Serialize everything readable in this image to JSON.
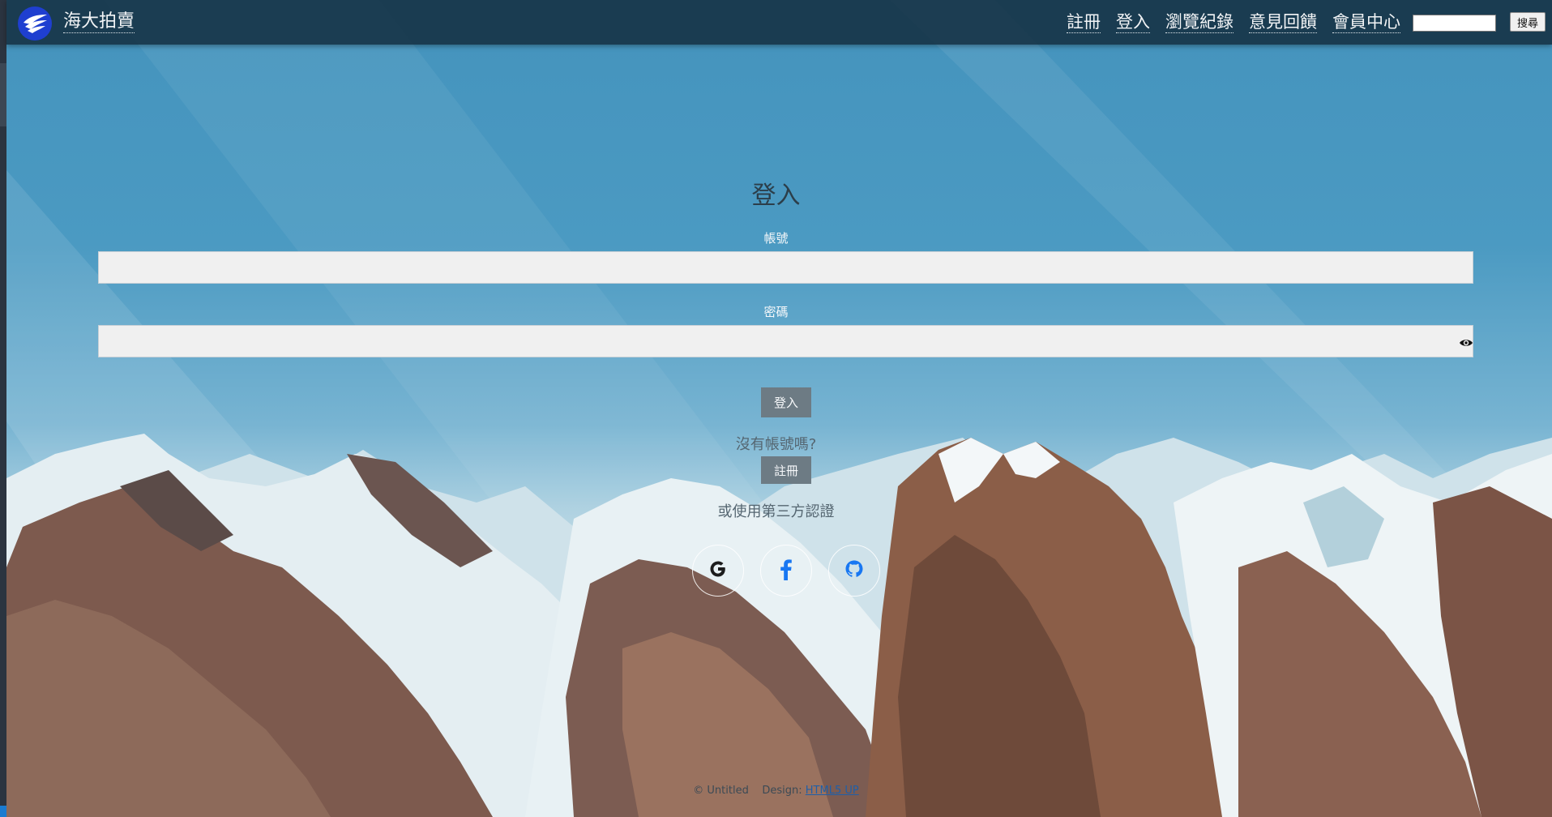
{
  "header": {
    "site_title": "海大拍賣",
    "nav": [
      "註冊",
      "登入",
      "瀏覽紀錄",
      "意見回饋",
      "會員中心"
    ],
    "search_value": "",
    "search_button": "搜尋"
  },
  "form": {
    "title": "登入",
    "account_label": "帳號",
    "account_value": "",
    "password_label": "密碼",
    "password_value": "",
    "login_button": "登入",
    "no_account_text": "沒有帳號嗎?",
    "register_button": "註冊",
    "third_party_text": "或使用第三方認證",
    "social": [
      {
        "name": "google",
        "icon": "google-icon"
      },
      {
        "name": "facebook",
        "icon": "facebook-icon"
      },
      {
        "name": "github",
        "icon": "github-icon"
      }
    ]
  },
  "footer": {
    "copyright": "© Untitled",
    "design_prefix": "Design:",
    "design_link": "HTML5 UP"
  },
  "colors": {
    "topbar": "#143042",
    "sky": "#4493bd",
    "input_bg": "#f0f0f0",
    "button_bg": "#6d7b84",
    "logo": "#1f3fd0"
  }
}
